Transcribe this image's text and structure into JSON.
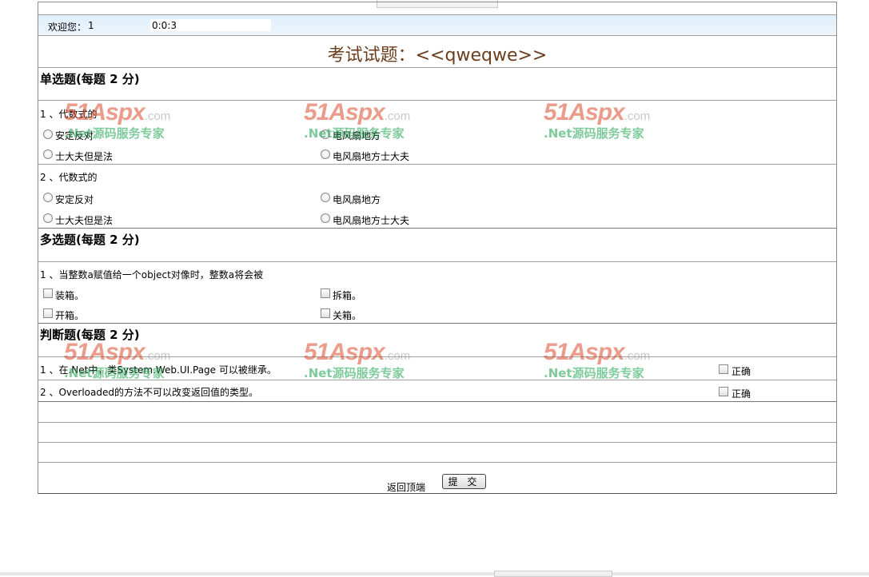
{
  "header": {
    "welcome_label": "欢迎您：",
    "user": "1",
    "timer": "0:0:3"
  },
  "exam": {
    "title": "考试试题：<<qweqwe>>"
  },
  "single_choice": {
    "title": "单选题(每题 2 分)",
    "questions": [
      {
        "text": "1 、代数式的",
        "options": [
          "安定反对",
          "电风扇地方",
          "士大夫但是法",
          "电风扇地方士大夫"
        ]
      },
      {
        "text": "2 、代数式的",
        "options": [
          "安定反对",
          "电风扇地方",
          "士大夫但是法",
          "电风扇地方士大夫"
        ]
      }
    ]
  },
  "multi_choice": {
    "title": "多选题(每题 2 分)",
    "questions": [
      {
        "text": "1 、当整数a赋值给一个object对像时，整数a将会被",
        "options": [
          "装箱。",
          "拆箱。",
          "开箱。",
          "关箱。"
        ]
      }
    ]
  },
  "true_false": {
    "title": "判断题(每题 2 分)",
    "questions": [
      {
        "text": "1 、在.Net中，类System.Web.UI.Page 可以被继承。",
        "option": "正确"
      },
      {
        "text": "2 、Overloaded的方法不可以改变返回值的类型。",
        "option": "正确"
      }
    ]
  },
  "footer": {
    "back_to_top": "返回顶端",
    "submit_label": "提 交"
  },
  "watermark": {
    "logo": "51Aspx",
    "logo_suffix": ".com",
    "slogan": ".Net源码服务专家"
  }
}
